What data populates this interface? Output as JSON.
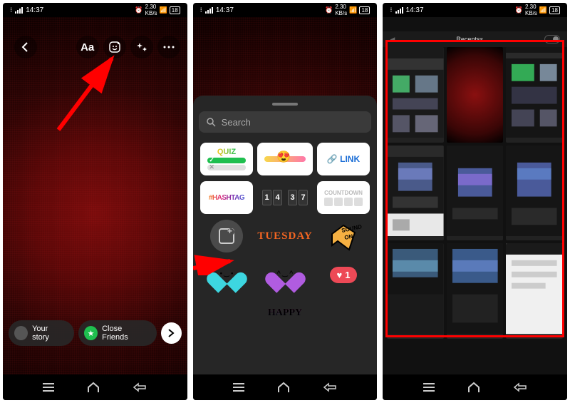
{
  "status": {
    "time": "14:37",
    "battery": "18"
  },
  "phone1": {
    "tool_text": "Aa",
    "your_story": "Your story",
    "close_friends": "Close Friends"
  },
  "phone2": {
    "search_placeholder": "Search",
    "stickers": {
      "quiz": "QUIZ",
      "link": "LINK",
      "hashtag": "#HASHTAG",
      "time_digits": [
        "1",
        "4",
        "3",
        "7"
      ],
      "countdown": "COUNTDOWN",
      "tuesday": "TUESDAY",
      "sound_on": "SOUND ON",
      "like_count": "1",
      "happy": "HAPPY"
    }
  },
  "phone3": {
    "header": "Recents"
  }
}
